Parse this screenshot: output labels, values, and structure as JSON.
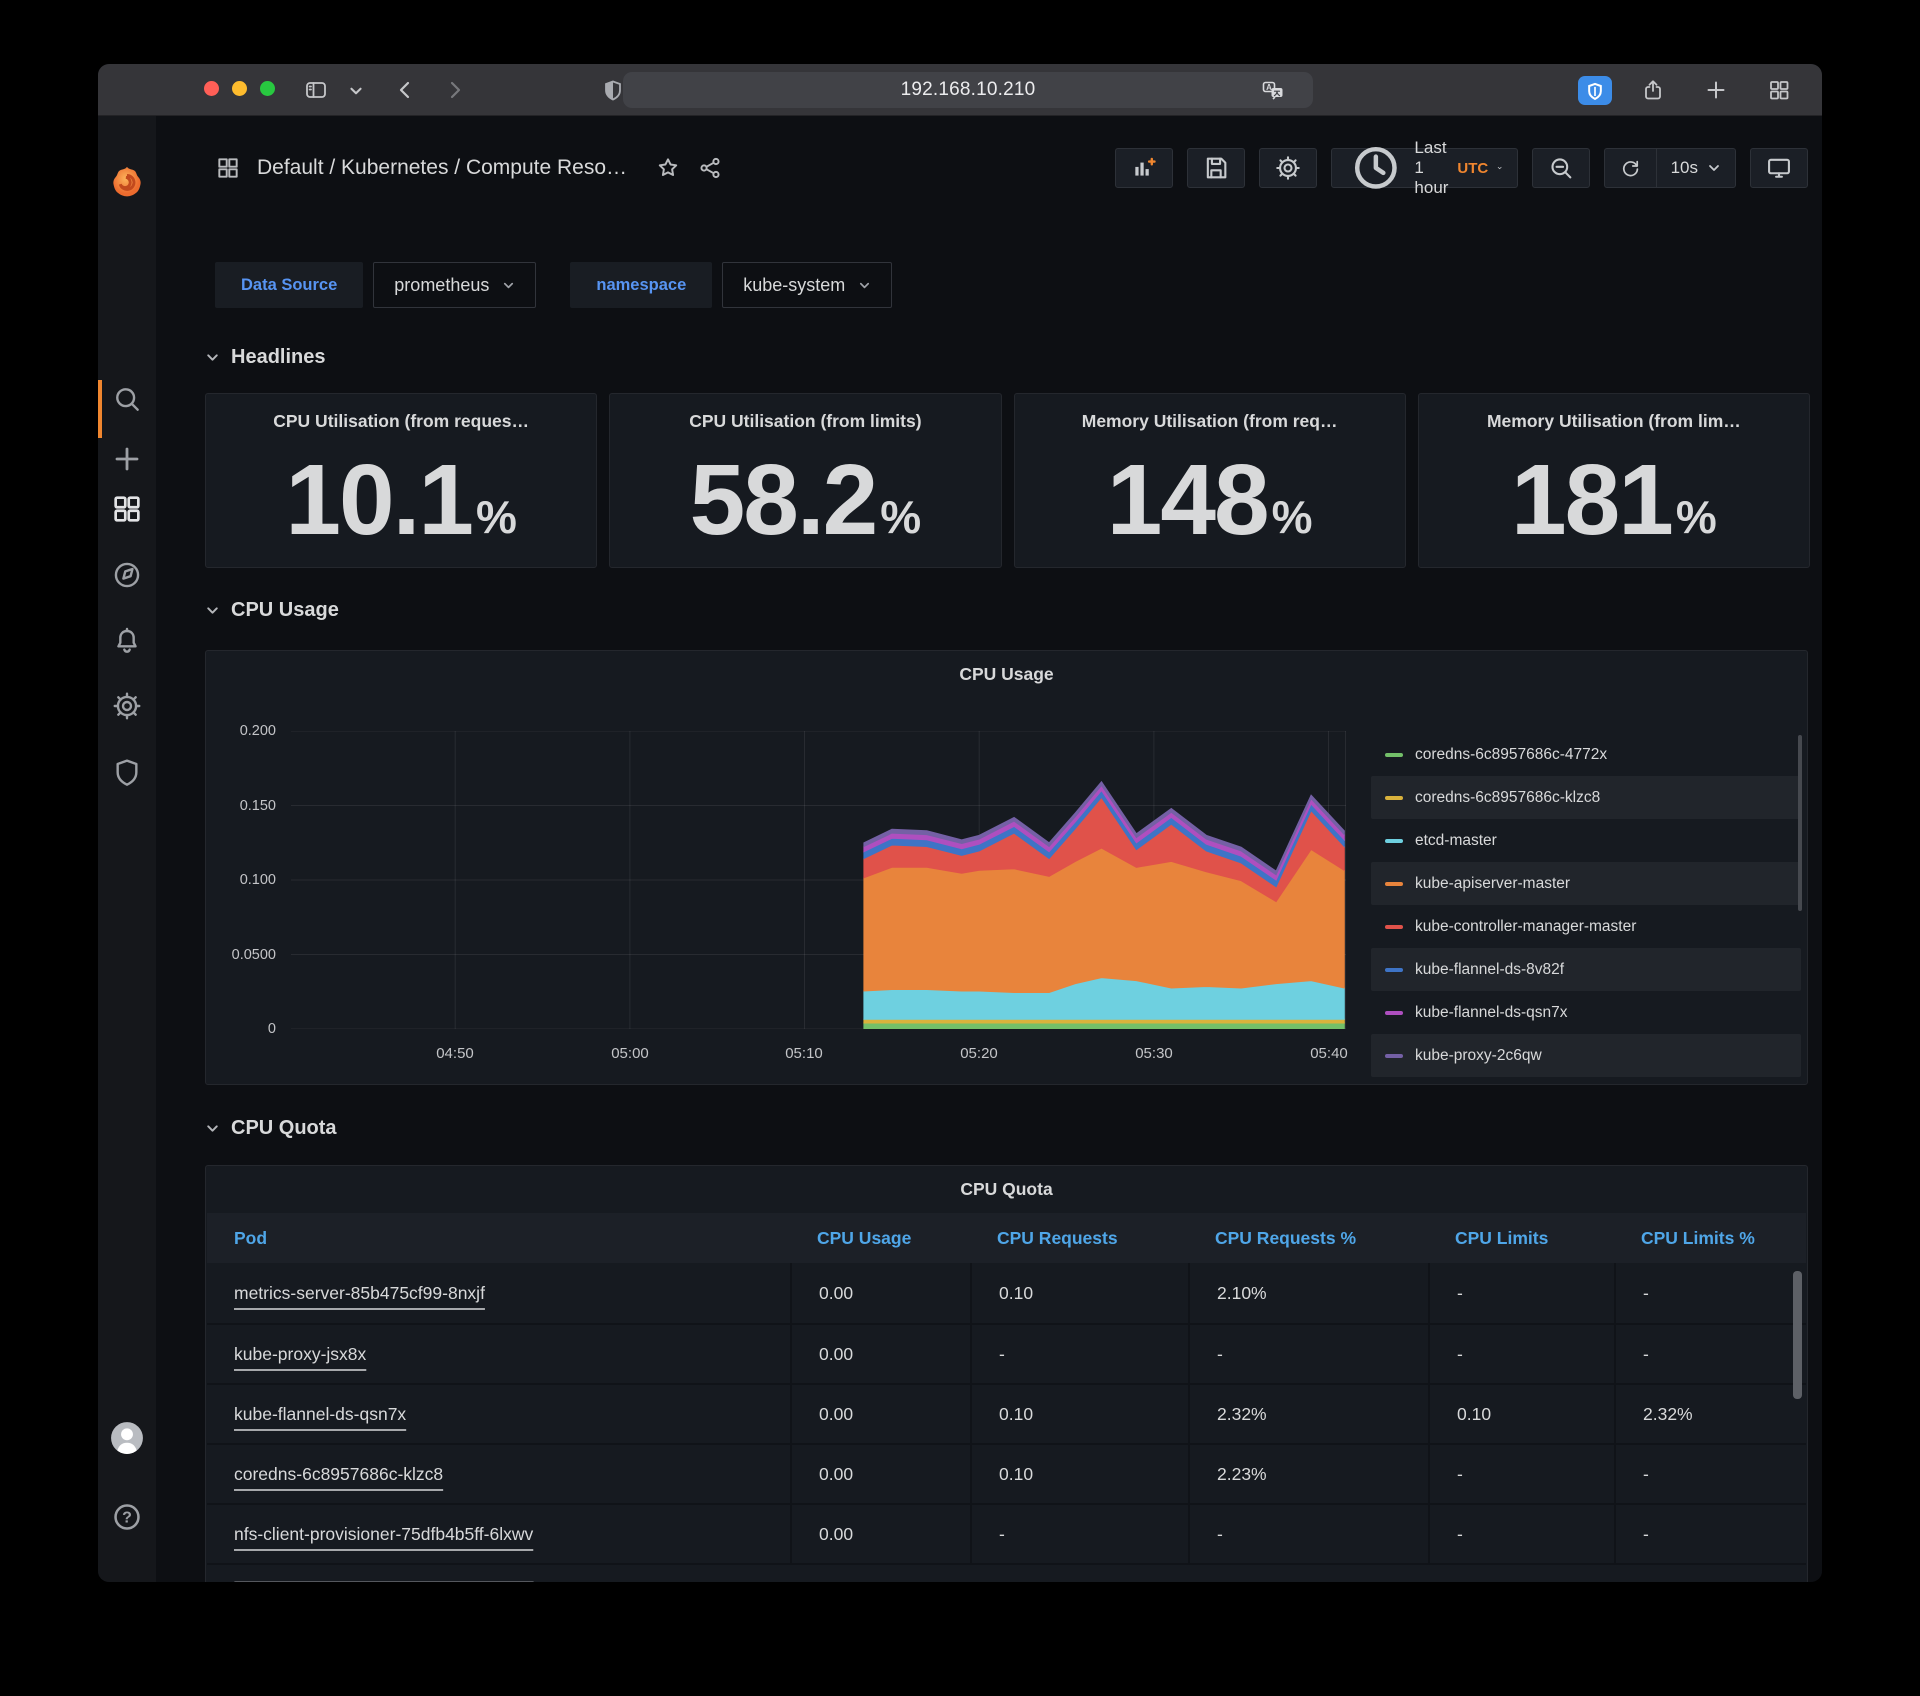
{
  "browser": {
    "url": "192.168.10.210"
  },
  "header": {
    "breadcrumb": "Default / Kubernetes / Compute Reso…",
    "time_range": "Last 1 hour",
    "timezone": "UTC",
    "refresh_interval": "10s"
  },
  "variables": [
    {
      "label": "Data Source",
      "value": "prometheus"
    },
    {
      "label": "namespace",
      "value": "kube-system"
    }
  ],
  "sections": {
    "headlines": "Headlines",
    "cpu_usage": "CPU Usage",
    "cpu_quota": "CPU Quota"
  },
  "stats": [
    {
      "title": "CPU Utilisation (from reques…",
      "value": "10.1",
      "unit": "%"
    },
    {
      "title": "CPU Utilisation (from limits)",
      "value": "58.2",
      "unit": "%"
    },
    {
      "title": "Memory Utilisation (from req…",
      "value": "148",
      "unit": "%"
    },
    {
      "title": "Memory Utilisation (from lim…",
      "value": "181",
      "unit": "%"
    }
  ],
  "chart_data": {
    "type": "area",
    "stacked": true,
    "title": "CPU Usage",
    "legend_position": "right",
    "grid": true,
    "ylim": [
      0,
      0.2
    ],
    "x_domain_minutes": [
      -19.4,
      41
    ],
    "x_minutes": [
      13.4,
      15,
      17,
      19,
      20,
      22,
      24,
      25.5,
      27,
      29,
      31,
      33,
      35,
      37,
      39,
      40.9
    ],
    "x_ticks": [
      {
        "t": -10,
        "label": "04:50"
      },
      {
        "t": 0,
        "label": "05:00"
      },
      {
        "t": 10,
        "label": "05:10"
      },
      {
        "t": 20,
        "label": "05:20"
      },
      {
        "t": 30,
        "label": "05:30"
      },
      {
        "t": 40,
        "label": "05:40"
      }
    ],
    "y_ticks": [
      {
        "v": 0.2,
        "label": "0.200"
      },
      {
        "v": 0.15,
        "label": "0.150"
      },
      {
        "v": 0.1,
        "label": "0.100"
      },
      {
        "v": 0.05,
        "label": "0.0500"
      },
      {
        "v": 0,
        "label": "0"
      }
    ],
    "series": [
      {
        "name": "coredns-6c8957686c-4772x",
        "color": "#73BF69",
        "values": [
          0.004,
          0.004,
          0.004,
          0.004,
          0.004,
          0.004,
          0.004,
          0.004,
          0.004,
          0.004,
          0.004,
          0.004,
          0.004,
          0.004,
          0.004,
          0.004
        ]
      },
      {
        "name": "coredns-6c8957686c-klzc8",
        "color": "#D9B23C",
        "values": [
          0.0025,
          0.0025,
          0.0025,
          0.0025,
          0.0025,
          0.0025,
          0.0025,
          0.0025,
          0.0025,
          0.0025,
          0.0025,
          0.0025,
          0.0025,
          0.0025,
          0.0025,
          0.0025
        ]
      },
      {
        "name": "etcd-master",
        "color": "#6ED0E0",
        "values": [
          0.019,
          0.02,
          0.02,
          0.019,
          0.019,
          0.018,
          0.018,
          0.024,
          0.028,
          0.026,
          0.021,
          0.022,
          0.021,
          0.024,
          0.026,
          0.021
        ]
      },
      {
        "name": "kube-apiserver-master",
        "color": "#E8843C",
        "values": [
          0.076,
          0.082,
          0.082,
          0.079,
          0.081,
          0.083,
          0.078,
          0.082,
          0.087,
          0.076,
          0.085,
          0.077,
          0.072,
          0.055,
          0.088,
          0.079
        ]
      },
      {
        "name": "kube-controller-manager-master",
        "color": "#E0524A",
        "values": [
          0.013,
          0.015,
          0.014,
          0.012,
          0.013,
          0.024,
          0.012,
          0.022,
          0.034,
          0.012,
          0.025,
          0.014,
          0.012,
          0.01,
          0.026,
          0.016
        ]
      },
      {
        "name": "kube-flannel-ds-8v82f",
        "color": "#3E74C6",
        "values": [
          0.0045,
          0.0045,
          0.0045,
          0.0045,
          0.0045,
          0.0045,
          0.0045,
          0.0045,
          0.0045,
          0.0045,
          0.0045,
          0.0045,
          0.0045,
          0.0045,
          0.0045,
          0.0045
        ]
      },
      {
        "name": "kube-flannel-ds-qsn7x",
        "color": "#AE4FBF",
        "values": [
          0.0035,
          0.0035,
          0.0035,
          0.0035,
          0.0035,
          0.0035,
          0.0035,
          0.0035,
          0.0035,
          0.0035,
          0.0035,
          0.0035,
          0.0035,
          0.0035,
          0.0035,
          0.0035
        ]
      },
      {
        "name": "kube-proxy-2c6qw",
        "color": "#7460A5",
        "values": [
          0.0025,
          0.0025,
          0.0025,
          0.0025,
          0.0025,
          0.0025,
          0.0025,
          0.0025,
          0.0025,
          0.0025,
          0.0025,
          0.0025,
          0.0025,
          0.0025,
          0.0025,
          0.0025
        ]
      }
    ]
  },
  "table": {
    "title": "CPU Quota",
    "columns": [
      "Pod",
      "CPU Usage",
      "CPU Requests",
      "CPU Requests %",
      "CPU Limits",
      "CPU Limits %"
    ],
    "rows": [
      {
        "pod": "metrics-server-85b475cf99-8nxjf",
        "cpu_usage": "0.00",
        "cpu_requests": "0.10",
        "cpu_requests_pct": "2.10%",
        "cpu_limits": "-",
        "cpu_limits_pct": "-"
      },
      {
        "pod": "kube-proxy-jsx8x",
        "cpu_usage": "0.00",
        "cpu_requests": "-",
        "cpu_requests_pct": "-",
        "cpu_limits": "-",
        "cpu_limits_pct": "-"
      },
      {
        "pod": "kube-flannel-ds-qsn7x",
        "cpu_usage": "0.00",
        "cpu_requests": "0.10",
        "cpu_requests_pct": "2.32%",
        "cpu_limits": "0.10",
        "cpu_limits_pct": "2.32%"
      },
      {
        "pod": "coredns-6c8957686c-klzc8",
        "cpu_usage": "0.00",
        "cpu_requests": "0.10",
        "cpu_requests_pct": "2.23%",
        "cpu_limits": "-",
        "cpu_limits_pct": "-"
      },
      {
        "pod": "nfs-client-provisioner-75dfb4b5ff-6lxwv",
        "cpu_usage": "0.00",
        "cpu_requests": "-",
        "cpu_requests_pct": "-",
        "cpu_limits": "-",
        "cpu_limits_pct": "-"
      }
    ]
  },
  "colors": {
    "accent_orange": "#F0862F",
    "link_blue": "#5794F2",
    "table_header_blue": "#4FA6E8",
    "panel_bg": "#161A20",
    "page_bg": "#0D0F13",
    "bitwarden_blue": "#3C8CE8"
  },
  "icons": {
    "titlebar": [
      "sidebar-toggle",
      "chevron-down",
      "back",
      "forward",
      "privacy-shield",
      "shield-check",
      "translate",
      "reload",
      "bitwarden-shield",
      "share",
      "new-tab-plus",
      "tab-overview-grid"
    ],
    "sidebar": [
      "grafana-logo",
      "search",
      "plus",
      "dashboards-grid",
      "explore-compass",
      "alerting-bell",
      "settings-gear",
      "admin-shield",
      "avatar",
      "help"
    ],
    "toolbar": [
      "add-panel",
      "save",
      "gear",
      "clock",
      "zoom-out",
      "refresh",
      "tv-cycle",
      "star",
      "share-alt"
    ]
  }
}
